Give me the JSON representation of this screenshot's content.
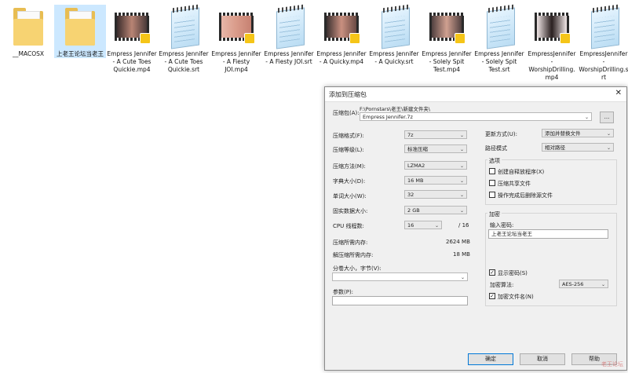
{
  "desktop": {
    "files": [
      {
        "label": "__MACOSX",
        "type": "folder"
      },
      {
        "label": "上老王论坛当老王",
        "type": "folder"
      },
      {
        "label": "Empress Jennifer - A Cute Toes Quickie.mp4",
        "type": "video"
      },
      {
        "label": "Empress Jennifer - A Cute Toes Quickie.srt",
        "type": "notepad"
      },
      {
        "label": "Empress Jennifer - A Fiesty JOI.mp4",
        "type": "video"
      },
      {
        "label": "Empress Jennifer - A Fiesty JOI.srt",
        "type": "notepad"
      },
      {
        "label": "Empress Jennifer - A Quicky.mp4",
        "type": "video"
      },
      {
        "label": "Empress Jennifer - A Quicky.srt",
        "type": "notepad"
      },
      {
        "label": "Empress Jennifer - Solely Spit Test.mp4",
        "type": "video"
      },
      {
        "label": "Empress Jennifer - Solely Spit Test.srt",
        "type": "notepad"
      },
      {
        "label": "EmpressJennifer - WorshipDrilling.mp4",
        "type": "video"
      },
      {
        "label": "EmpressJennifer - WorshipDrilling.srt",
        "type": "notepad"
      }
    ]
  },
  "dialog": {
    "title": "添加到压缩包",
    "close": "✕",
    "archive_label": "压缩包(A):",
    "archive_path": "F:\\Pornstars\\老王\\新建文件夹\\",
    "archive_name": "Empress Jennifer.7z",
    "browse": "...",
    "format_label": "压缩格式(F):",
    "format_value": "7z",
    "level_label": "压缩等级(L):",
    "level_value": "标准压缩",
    "method_label": "压缩方法(M):",
    "method_value": "LZMA2",
    "dict_label": "字典大小(D):",
    "dict_value": "16 MB",
    "word_label": "单词大小(W):",
    "word_value": "32",
    "solid_label": "固实数据大小:",
    "solid_value": "2 GB",
    "cpu_label": "CPU 线程数:",
    "cpu_value": "16",
    "cpu_total": "/ 16",
    "mem_comp_label": "压缩所需内存:",
    "mem_comp_value": "2624 MB",
    "mem_decomp_label": "解压缩所需内存:",
    "mem_decomp_value": "18 MB",
    "split_label": "分卷大小，字节(V):",
    "params_label": "参数(P):",
    "update_label": "更新方式(U):",
    "update_value": "添加并替换文件",
    "pathmode_label": "路径模式",
    "pathmode_value": "相对路径",
    "options_title": "选项",
    "opt_sfx": "创建自释放程序(X)",
    "opt_shared": "压缩共享文件",
    "opt_delete": "操作完成后删除源文件",
    "encrypt_title": "加密",
    "pwd_label": "输入密码:",
    "pwd_value": "上老王论坛当老王",
    "show_pwd": "显示密码(S)",
    "enc_method_label": "加密算法:",
    "enc_method_value": "AES-256",
    "enc_names": "加密文件名(N)",
    "ok": "确定",
    "cancel": "取消",
    "help": "帮助",
    "check": "✓",
    "arrow": "⌄"
  },
  "watermark": "老王论坛"
}
